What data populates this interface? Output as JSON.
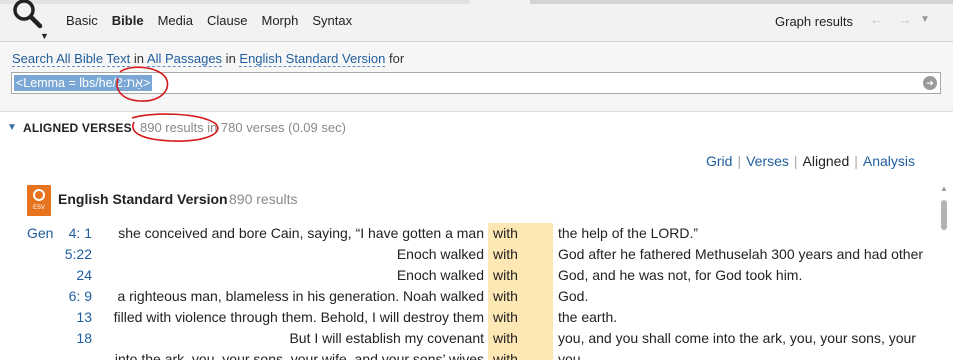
{
  "toolbar": {
    "tabs": [
      {
        "label": "Basic",
        "active": false
      },
      {
        "label": "Bible",
        "active": true
      },
      {
        "label": "Media",
        "active": false
      },
      {
        "label": "Clause",
        "active": false
      },
      {
        "label": "Morph",
        "active": false
      },
      {
        "label": "Syntax",
        "active": false
      }
    ],
    "graph_label": "Graph results",
    "nav_arrows": "← →",
    "nav_caret": "▼"
  },
  "query": {
    "prefix_link": "Search All Bible Text",
    "in1": " in ",
    "range_link": "All Passages",
    "in2": " in ",
    "version_link": "English Standard Version",
    "for": " for",
    "value": "<Lemma = lbs/he/2:אֵת>",
    "go": "➜"
  },
  "aligned": {
    "title": "ALIGNED VERSES",
    "count": "890 results in 780 verses (0.09 sec)"
  },
  "views": [
    "Grid",
    "Verses",
    "Aligned",
    "Analysis"
  ],
  "version": {
    "badge": "ESV",
    "title": "English Standard Version",
    "count": "890 results"
  },
  "rows": [
    {
      "book": "Gen",
      "ref": "4:  1",
      "pre": "she conceived and bore Cain, saying, “I have gotten a man",
      "kw": "with",
      "post": "the help of the LORD.”"
    },
    {
      "book": "",
      "ref": "5:22",
      "pre": "Enoch walked",
      "kw": "with",
      "post": "God after he fathered Methuselah 300 years and had other"
    },
    {
      "book": "",
      "ref": "24",
      "pre": "Enoch walked",
      "kw": "with",
      "post": "God, and he was not, for God took him."
    },
    {
      "book": "",
      "ref": "6:  9",
      "pre": "a righteous man, blameless in his generation. Noah walked",
      "kw": "with",
      "post": "God."
    },
    {
      "book": "",
      "ref": "13",
      "pre": "filled with violence through them. Behold, I will destroy them",
      "kw": "with",
      "post": "the earth."
    },
    {
      "book": "",
      "ref": "18",
      "pre": "But I will establish my covenant",
      "kw": "with",
      "post": "you, and you shall come into the ark, you, your sons, your"
    },
    {
      "book": "",
      "ref": "",
      "pre": "into the ark, you, your sons, your wife, and your sons’ wives",
      "kw": "with",
      "post": "you."
    }
  ],
  "colors": {
    "accent": "#1f5d9e",
    "highlight": "#fde7b4",
    "esv_badge": "#e8731f",
    "annotation": "#d41a1a"
  }
}
